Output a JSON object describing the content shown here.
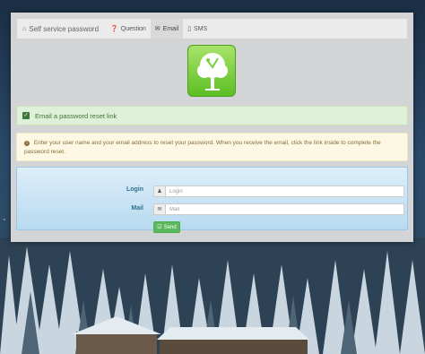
{
  "nav": {
    "brand": "Self service password",
    "brand_icon": "home-icon",
    "tabs": [
      {
        "label": "Question",
        "icon": "question-circle-icon"
      },
      {
        "label": "Email",
        "icon": "envelope-icon",
        "active": true
      },
      {
        "label": "SMS",
        "icon": "mobile-icon"
      }
    ]
  },
  "title_alert": {
    "text": "Email a password reset link",
    "color": "#dff0d8"
  },
  "info_alert": {
    "text": "Enter your user name and your email address to reset your password. When you receive the email, click the link inside to complete the password reset.",
    "color": "#fcf8e3"
  },
  "form": {
    "login_label": "Login",
    "login_placeholder": "Login",
    "mail_label": "Mail",
    "mail_placeholder": "Mail",
    "send_label": "Send"
  },
  "colors": {
    "accent_green": "#5cb85c",
    "label_blue": "#31708f"
  }
}
